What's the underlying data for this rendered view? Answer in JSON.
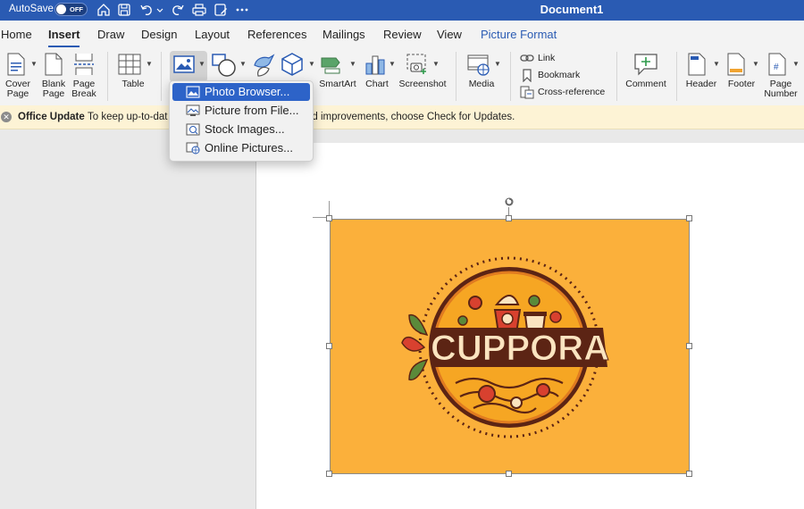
{
  "titlebar": {
    "autosave_label": "AutoSave",
    "autosave_state": "OFF",
    "document_title": "Document1"
  },
  "tabs": [
    {
      "label": "Home"
    },
    {
      "label": "Insert"
    },
    {
      "label": "Draw"
    },
    {
      "label": "Design"
    },
    {
      "label": "Layout"
    },
    {
      "label": "References"
    },
    {
      "label": "Mailings"
    },
    {
      "label": "Review"
    },
    {
      "label": "View"
    },
    {
      "label": "Picture Format"
    }
  ],
  "ribbon": {
    "cover_page": "Cover Page",
    "cover_page_l1": "Cover",
    "cover_page_l2": "Page",
    "blank_page_l1": "Blank",
    "blank_page_l2": "Page",
    "page_break_l1": "Page",
    "page_break_l2": "Break",
    "table": "Table",
    "smartart": "SmartArt",
    "chart": "Chart",
    "screenshot": "Screenshot",
    "media": "Media",
    "link": "Link",
    "bookmark": "Bookmark",
    "cross_reference": "Cross-reference",
    "comment": "Comment",
    "header": "Header",
    "footer": "Footer",
    "page_number_l1": "Page",
    "page_number_l2": "Number"
  },
  "message_bar": {
    "title": "Office Update",
    "text_left": "To keep up-to-dat",
    "text_right": "nd improvements, choose Check for Updates."
  },
  "pictures_menu": {
    "items": [
      {
        "label": "Photo Browser...",
        "selected": true
      },
      {
        "label": "Picture from File...",
        "selected": false
      },
      {
        "label": "Stock Images...",
        "selected": false
      },
      {
        "label": "Online Pictures...",
        "selected": false
      }
    ]
  },
  "logo": {
    "text": "CUPPORA",
    "background_color": "#fbb03b",
    "ring_color": "#5c2414",
    "accent_red": "#d8412f",
    "accent_green": "#5b8a3a"
  },
  "colors": {
    "titlebar": "#2a5bb3",
    "selection": "#2d63c8",
    "message_bar": "#fdf3d5"
  }
}
